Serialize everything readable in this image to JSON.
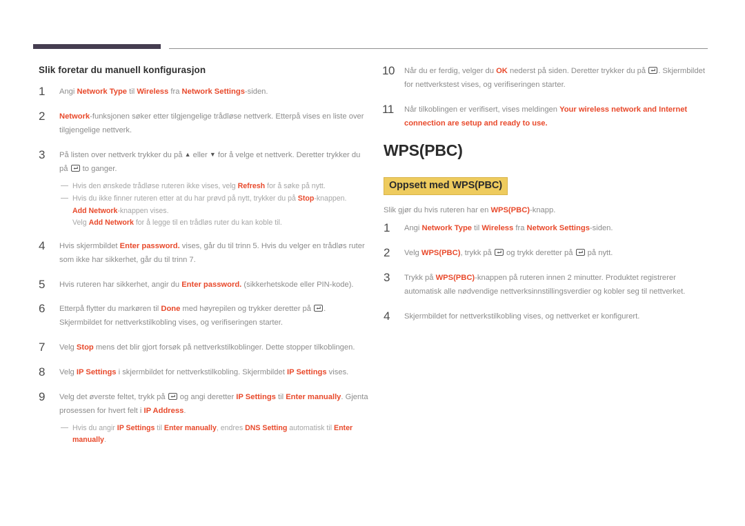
{
  "colors": {
    "accent_highlight": "#e8492b",
    "header_bar": "#453d50",
    "subhead_background": "#eecb5e",
    "subhead_border": "#d8b44a",
    "body_text": "#8c8c8c",
    "note_text": "#a6a6a6",
    "step_number": "#4a4a4a",
    "heading_text": "#2b2b2b"
  },
  "icons": {
    "enter_key": "enter-key-icon",
    "arrow_up": "▲",
    "arrow_down": "▼"
  },
  "left_column": {
    "heading": "Slik foretar du manuell konfigurasjon",
    "steps": [
      {
        "number": "1",
        "text_html": "Angi <b class=\"hl\">Network Type</b> til <b class=\"hl\">Wireless</b> fra <b class=\"hl\">Network Settings</b>-siden."
      },
      {
        "number": "2",
        "text_html": "<b class=\"hl\">Network</b>-funksjonen søker etter tilgjengelige trådløse nettverk. Etterpå vises en liste over tilgjengelige nettverk."
      },
      {
        "number": "3",
        "text_html": "På listen over nettverk trykker du på <span class=\"tri\">▲</span> eller <span class=\"tri\">▼</span> for å velge et nettverk. Deretter trykker du på {{ENTER}} to ganger.",
        "notes": [
          {
            "text_html": "Hvis den ønskede trådløse ruteren ikke vises, velg <b class=\"hl\">Refresh</b> for å søke på nytt."
          },
          {
            "text_html": "Hvis du ikke finner ruteren etter at du har prøvd på nytt, trykker du på <b class=\"hl\">Stop</b>-knappen.",
            "continuations": [
              "<b class=\"hl\">Add Network</b>-knappen vises.",
              "Velg <b class=\"hl\">Add Network</b> for å legge til en trådløs ruter du kan koble til."
            ]
          }
        ]
      },
      {
        "number": "4",
        "text_html": "Hvis skjermbildet <b class=\"hl\">Enter password.</b> vises, går du til trinn 5. Hvis du velger en trådløs ruter som ikke har sikkerhet, går du til trinn 7."
      },
      {
        "number": "5",
        "text_html": "Hvis ruteren har sikkerhet, angir du <b class=\"hl\">Enter password.</b> (sikkerhetskode eller PIN-kode)."
      },
      {
        "number": "6",
        "text_html": "Etterpå flytter du markøren til <b class=\"hl\">Done</b> med høyrepilen og trykker deretter på {{ENTER}}. Skjermbildet for nettverkstilkobling vises, og verifiseringen starter."
      },
      {
        "number": "7",
        "text_html": "Velg <b class=\"hl\">Stop</b> mens det blir gjort forsøk på nettverkstilkoblinger. Dette stopper tilkoblingen."
      },
      {
        "number": "8",
        "text_html": "Velg <b class=\"hl\">IP Settings</b> i skjermbildet for nettverkstilkobling. Skjermbildet <b class=\"hl\">IP Settings</b> vises."
      },
      {
        "number": "9",
        "text_html": "Velg det øverste feltet, trykk på {{ENTER}} og angi deretter <b class=\"hl\">IP Settings</b> til <b class=\"hl\">Enter manually</b>. Gjenta prosessen for hvert felt i <b class=\"hl\">IP Address</b>.",
        "notes": [
          {
            "text_html": "Hvis du angir <b class=\"hl\">IP Settings</b> til <b class=\"hl\">Enter manually</b>, endres <b class=\"hl\">DNS Setting</b> automatisk til <b class=\"hl\">Enter manually</b>."
          }
        ]
      }
    ]
  },
  "right_column": {
    "continued_steps": [
      {
        "number": "10",
        "text_html": "Når du er ferdig, velger du <b class=\"hl\">OK</b> nederst på siden. Deretter trykker du på {{ENTER}}. Skjermbildet for nettverkstest vises, og verifiseringen starter."
      },
      {
        "number": "11",
        "text_html": "Når tilkoblingen er verifisert, vises meldingen <b class=\"hl\">Your wireless network and Internet connection are setup and ready to use.</b>"
      }
    ],
    "chapter_title": "WPS(PBC)",
    "subhead": "Oppsett med WPS(PBC)",
    "intro_html": "Slik gjør du hvis ruteren har en <b class=\"hl\">WPS(PBC)</b>-knapp.",
    "steps": [
      {
        "number": "1",
        "text_html": "Angi <b class=\"hl\">Network Type</b> til <b class=\"hl\">Wireless</b> fra <b class=\"hl\">Network Settings</b>-siden."
      },
      {
        "number": "2",
        "text_html": "Velg <b class=\"hl\">WPS(PBC)</b>, trykk på {{ENTER}} og trykk deretter på {{ENTER}} på nytt."
      },
      {
        "number": "3",
        "text_html": "Trykk på <b class=\"hl\">WPS(PBC)</b>-knappen på ruteren innen 2 minutter. Produktet registrerer automatisk alle nødvendige nettverksinnstillingsverdier og kobler seg til nettverket."
      },
      {
        "number": "4",
        "text_html": "Skjermbildet for nettverkstilkobling vises, og nettverket er konfigurert."
      }
    ]
  }
}
